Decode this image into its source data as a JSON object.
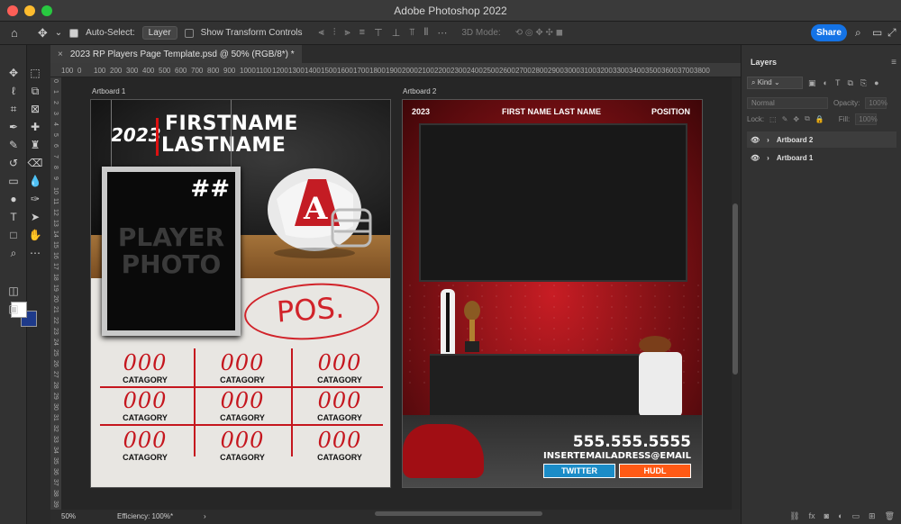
{
  "window": {
    "title": "Adobe Photoshop 2022"
  },
  "options_bar": {
    "auto_select_label": "Auto-Select:",
    "auto_select_value": "Layer",
    "show_transform_label": "Show Transform Controls",
    "mode_3d_label": "3D Mode:",
    "share_label": "Share"
  },
  "document": {
    "tab_title": "2023 RP Players Page Template.psd @ 50% (RGB/8*) *",
    "zoom": "50%",
    "efficiency": "Efficiency: 100%*"
  },
  "rulers": {
    "h_ticks": [
      "100",
      "0",
      "100",
      "200",
      "300",
      "400",
      "500",
      "600",
      "700",
      "800",
      "900",
      "1000",
      "1100",
      "1200",
      "1300",
      "1400",
      "1500",
      "1600",
      "1700",
      "1800",
      "1900",
      "2000",
      "2100",
      "2200",
      "2300",
      "2400",
      "2500",
      "2600",
      "2700",
      "2800",
      "2900",
      "3000",
      "3100",
      "3200",
      "3300",
      "3400",
      "3500",
      "3600",
      "3700",
      "3800"
    ],
    "v_ticks": [
      "0",
      "1",
      "2",
      "3",
      "4",
      "5",
      "6",
      "7",
      "8",
      "9",
      "10",
      "11",
      "12",
      "13",
      "14",
      "15",
      "16",
      "17",
      "18",
      "19",
      "20",
      "21",
      "22",
      "23",
      "24",
      "25",
      "26",
      "27",
      "28",
      "29",
      "30",
      "31",
      "32",
      "33",
      "34",
      "35",
      "36",
      "37",
      "38",
      "39",
      "40"
    ]
  },
  "artboard1": {
    "label": "Artboard 1",
    "year": "2023",
    "firstname": "FIRSTNAME",
    "lastname": "LASTNAME",
    "number": "##",
    "photo_line1": "PLAYER",
    "photo_line2": "PHOTO",
    "pos": "POS.",
    "helmet_letter": "A",
    "stats": [
      {
        "value": "000",
        "category": "CATAGORY"
      },
      {
        "value": "000",
        "category": "CATAGORY"
      },
      {
        "value": "000",
        "category": "CATAGORY"
      },
      {
        "value": "000",
        "category": "CATAGORY"
      },
      {
        "value": "000",
        "category": "CATAGORY"
      },
      {
        "value": "000",
        "category": "CATAGORY"
      },
      {
        "value": "000",
        "category": "CATAGORY"
      },
      {
        "value": "000",
        "category": "CATAGORY"
      },
      {
        "value": "000",
        "category": "CATAGORY"
      }
    ]
  },
  "artboard2": {
    "label": "Artboard 2",
    "year": "2023",
    "name": "FIRST NAME LAST NAME",
    "position": "POSITION",
    "phone": "555.555.5555",
    "email": "INSERTEMAILADRESS@EMAIL",
    "twitter": "TWITTER",
    "hudl": "HUDL"
  },
  "layers_panel": {
    "tab": "Layers",
    "kind": "Kind",
    "blend_mode": "Normal",
    "opacity_label": "Opacity:",
    "opacity_value": "100%",
    "lock_label": "Lock:",
    "fill_label": "Fill:",
    "fill_value": "100%",
    "layers": [
      {
        "name": "Artboard 2"
      },
      {
        "name": "Artboard 1"
      }
    ]
  },
  "colors": {
    "accent": "#1473e6",
    "stat_red": "#c5161e",
    "twitter_blue": "#1b8cc7",
    "hudl_orange": "#ff5a15"
  }
}
